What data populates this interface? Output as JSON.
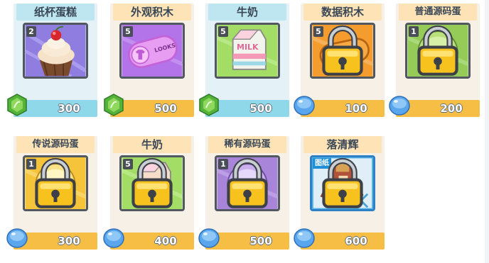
{
  "items": [
    {
      "name": "纸杯蛋糕",
      "qty": "2",
      "price": "300",
      "currency": "green-gem-icon",
      "locked": false,
      "bg": "#8b7fd9",
      "icon": "cupcake-icon"
    },
    {
      "name": "外观积木",
      "qty": "5",
      "price": "500",
      "currency": "green-gem-icon",
      "locked": false,
      "bg": "#b070e6",
      "icon": "look-block-icon",
      "icon_text": "LOOKS"
    },
    {
      "name": "牛奶",
      "qty": "5",
      "price": "500",
      "currency": "green-gem-icon",
      "locked": false,
      "bg": "#a5dc66",
      "icon": "milk-carton-icon",
      "icon_text": "MILK"
    },
    {
      "name": "数据积木",
      "qty": "5",
      "price": "100",
      "currency": "blue-crystal-icon",
      "locked": true,
      "bg": "#f29a2b",
      "icon": "data-block-icon"
    },
    {
      "name": "普通源码蛋",
      "qty": "1",
      "price": "200",
      "currency": "blue-crystal-icon",
      "locked": true,
      "bg": "#94cc57",
      "icon": "common-code-egg-icon"
    },
    {
      "name": "传说源码蛋",
      "qty": "1",
      "price": "300",
      "currency": "blue-crystal-icon",
      "locked": true,
      "bg": "#f4c238",
      "icon": "legendary-code-egg-icon"
    },
    {
      "name": "牛奶",
      "qty": "5",
      "price": "400",
      "currency": "blue-crystal-icon",
      "locked": true,
      "bg": "#a5dc66",
      "icon": "milk-carton-icon"
    },
    {
      "name": "稀有源码蛋",
      "qty": "1",
      "price": "500",
      "currency": "blue-crystal-icon",
      "locked": true,
      "bg": "#a884d8",
      "icon": "rare-code-egg-icon"
    },
    {
      "name": "落清辉",
      "qty": "",
      "price": "600",
      "currency": "blue-crystal-icon",
      "locked": true,
      "bg": "#4fb2e8",
      "icon": "outfit-blueprint-icon",
      "tag": "图纸"
    }
  ]
}
